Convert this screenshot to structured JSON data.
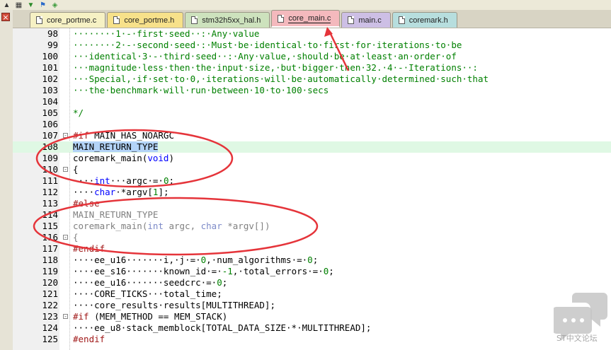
{
  "tabs": [
    {
      "label": "core_portme.c",
      "color": "#f6f1c4",
      "active": false
    },
    {
      "label": "core_portme.h",
      "color": "#f7e18a",
      "active": false
    },
    {
      "label": "stm32h5xx_hal.h",
      "color": "#cde2bd",
      "active": false
    },
    {
      "label": "core_main.c",
      "color": "#f4b9bd",
      "active": true
    },
    {
      "label": "main.c",
      "color": "#cdbfe5",
      "active": false
    },
    {
      "label": "coremark.h",
      "color": "#b7dede",
      "active": false
    }
  ],
  "colors": {
    "annotation_red": "#e5343a",
    "highlight_green": "#dff8e4",
    "selection_blue": "#b3d3f7"
  },
  "icons": [
    "arrow-up-icon",
    "build-icon",
    "download-icon",
    "flag-icon",
    "debug-icon"
  ],
  "close_button": "×",
  "code": [
    {
      "n": "98",
      "fold": "",
      "hl": false,
      "seg": [
        [
          "cm",
          "········1·-·first·seed··:·Any·value"
        ]
      ]
    },
    {
      "n": "99",
      "fold": "",
      "hl": false,
      "seg": [
        [
          "cm",
          "········2·-·second·seed·:·Must·be·identical·to·first·for·iterations·to·be"
        ]
      ]
    },
    {
      "n": "100",
      "fold": "",
      "hl": false,
      "seg": [
        [
          "cm",
          "···identical·3·-·third·seed··:·Any·value,·should·be·at·least·an·order·of"
        ]
      ]
    },
    {
      "n": "101",
      "fold": "",
      "hl": false,
      "seg": [
        [
          "cm",
          "···magnitude·less·then·the·input·size,·but·bigger·then·32.·4·-·Iterations··:"
        ]
      ]
    },
    {
      "n": "102",
      "fold": "",
      "hl": false,
      "seg": [
        [
          "cm",
          "···Special,·if·set·to·0,·iterations·will·be·automatically·determined·such·that"
        ]
      ]
    },
    {
      "n": "103",
      "fold": "",
      "hl": false,
      "seg": [
        [
          "cm",
          "···the·benchmark·will·run·between·10·to·100·secs"
        ]
      ]
    },
    {
      "n": "104",
      "fold": "",
      "hl": false,
      "seg": [
        [
          "cm",
          ""
        ]
      ]
    },
    {
      "n": "105",
      "fold": "",
      "hl": false,
      "seg": [
        [
          "cm",
          "*/"
        ]
      ]
    },
    {
      "n": "106",
      "fold": "",
      "hl": false,
      "seg": [
        [
          "nm",
          ""
        ]
      ]
    },
    {
      "n": "107",
      "fold": "-",
      "hl": false,
      "seg": [
        [
          "pp",
          "#if"
        ],
        [
          "nm",
          " MAIN_HAS_NOARGC"
        ]
      ]
    },
    {
      "n": "108",
      "fold": "",
      "hl": true,
      "seg": [
        [
          "sel",
          "MAIN_RETURN_TYPE"
        ]
      ]
    },
    {
      "n": "109",
      "fold": "",
      "hl": false,
      "seg": [
        [
          "nm",
          "coremark_main("
        ],
        [
          "kw",
          "void"
        ],
        [
          "nm",
          ")"
        ]
      ]
    },
    {
      "n": "110",
      "fold": "-",
      "hl": false,
      "seg": [
        [
          "nm",
          "{"
        ]
      ]
    },
    {
      "n": "111",
      "fold": "",
      "hl": false,
      "seg": [
        [
          "nm",
          "····"
        ],
        [
          "kw",
          "int"
        ],
        [
          "nm",
          "···argc·=·"
        ],
        [
          "cm",
          "0"
        ],
        [
          "nm",
          ";"
        ]
      ]
    },
    {
      "n": "112",
      "fold": "",
      "hl": false,
      "seg": [
        [
          "nm",
          "····"
        ],
        [
          "kw",
          "char"
        ],
        [
          "nm",
          "·*argv["
        ],
        [
          "cm",
          "1"
        ],
        [
          "nm",
          "];"
        ]
      ]
    },
    {
      "n": "113",
      "fold": "",
      "hl": false,
      "seg": [
        [
          "pp",
          "#else"
        ]
      ]
    },
    {
      "n": "114",
      "fold": "",
      "hl": false,
      "seg": [
        [
          "gr",
          "MAIN_RETURN_TYPE"
        ]
      ]
    },
    {
      "n": "115",
      "fold": "",
      "hl": false,
      "seg": [
        [
          "gr",
          "coremark_main("
        ],
        [
          "kwg",
          "int"
        ],
        [
          "gr",
          " argc, "
        ],
        [
          "kwg",
          "char"
        ],
        [
          "gr",
          " *argv[])"
        ]
      ]
    },
    {
      "n": "116",
      "fold": "-",
      "hl": false,
      "seg": [
        [
          "gr",
          "{"
        ]
      ]
    },
    {
      "n": "117",
      "fold": "",
      "hl": false,
      "seg": [
        [
          "pp",
          "#endif"
        ]
      ]
    },
    {
      "n": "118",
      "fold": "",
      "hl": false,
      "seg": [
        [
          "nm",
          "····ee_u16·······i,·j·=·"
        ],
        [
          "cm",
          "0"
        ],
        [
          "nm",
          ",·num_algorithms·=·"
        ],
        [
          "cm",
          "0"
        ],
        [
          "nm",
          ";"
        ]
      ]
    },
    {
      "n": "119",
      "fold": "",
      "hl": false,
      "seg": [
        [
          "nm",
          "····ee_s16·······known_id·=·"
        ],
        [
          "cm",
          "-1"
        ],
        [
          "nm",
          ",·total_errors·=·"
        ],
        [
          "cm",
          "0"
        ],
        [
          "nm",
          ";"
        ]
      ]
    },
    {
      "n": "120",
      "fold": "",
      "hl": false,
      "seg": [
        [
          "nm",
          "····ee_u16·······seedcrc·=·"
        ],
        [
          "cm",
          "0"
        ],
        [
          "nm",
          ";"
        ]
      ]
    },
    {
      "n": "121",
      "fold": "",
      "hl": false,
      "seg": [
        [
          "nm",
          "····CORE_TICKS···total_time;"
        ]
      ]
    },
    {
      "n": "122",
      "fold": "",
      "hl": false,
      "seg": [
        [
          "nm",
          "····core_results·results[MULTITHREAD];"
        ]
      ]
    },
    {
      "n": "123",
      "fold": "-",
      "hl": false,
      "seg": [
        [
          "pp",
          "#if"
        ],
        [
          "nm",
          " (MEM_METHOD == MEM_STACK)"
        ]
      ]
    },
    {
      "n": "124",
      "fold": "",
      "hl": false,
      "seg": [
        [
          "nm",
          "····ee_u8·stack_memblock[TOTAL_DATA_SIZE·*·MULTITHREAD];"
        ]
      ]
    },
    {
      "n": "125",
      "fold": "",
      "hl": false,
      "seg": [
        [
          "pp",
          "#endif"
        ]
      ]
    }
  ],
  "watermark": {
    "text": "ST中文论坛"
  }
}
